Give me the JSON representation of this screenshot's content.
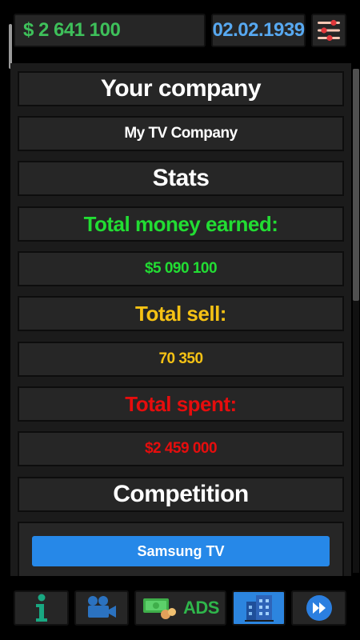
{
  "header": {
    "money": "$ 2 641 100",
    "date": "02.02.1939",
    "settings_icon": "sliders-icon"
  },
  "company": {
    "title": "Your company",
    "name": "My TV Company"
  },
  "stats": {
    "title": "Stats",
    "earned_label": "Total money earned:",
    "earned_value": "$5 090 100",
    "sell_label": "Total sell:",
    "sell_value": "70 350",
    "spent_label": "Total spent:",
    "spent_value": "$2 459 000"
  },
  "competition": {
    "title": "Competition",
    "competitors": [
      "Samsung TV"
    ]
  },
  "nav": {
    "info_icon": "info-icon",
    "studio_icon": "camera-icon",
    "ads_label": "ADS",
    "company_icon": "building-icon",
    "next_icon": "fast-forward-icon",
    "active": "company"
  },
  "colors": {
    "money_green": "#3ec05a",
    "date_blue": "#57a8f0",
    "earned_green": "#22dd33",
    "sell_yellow": "#f5c214",
    "spent_red": "#e60d0d",
    "accent_blue": "#2688e8"
  }
}
